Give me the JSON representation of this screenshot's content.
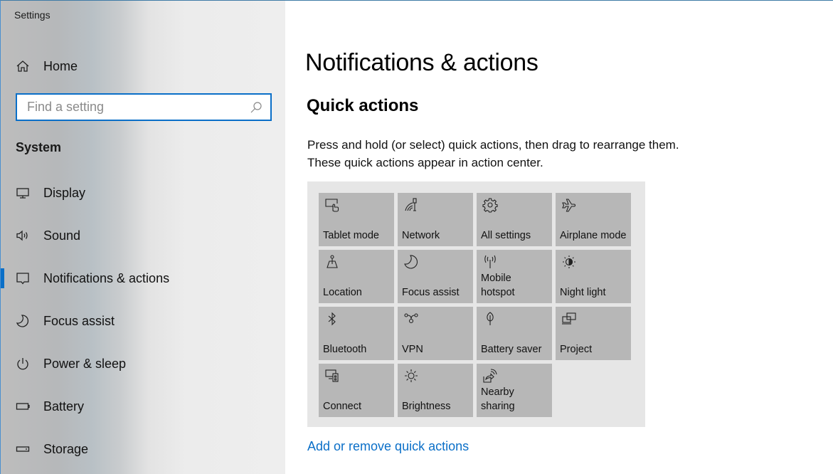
{
  "window": {
    "title": "Settings"
  },
  "sidebar": {
    "home": {
      "label": "Home",
      "icon": "home-icon"
    },
    "search": {
      "placeholder": "Find a setting",
      "value": "",
      "icon": "search-icon"
    },
    "section_label": "System",
    "items": [
      {
        "label": "Display",
        "icon": "display-icon",
        "active": false
      },
      {
        "label": "Sound",
        "icon": "speaker-icon",
        "active": false
      },
      {
        "label": "Notifications & actions",
        "icon": "notification-icon",
        "active": true
      },
      {
        "label": "Focus assist",
        "icon": "moon-icon",
        "active": false
      },
      {
        "label": "Power & sleep",
        "icon": "power-icon",
        "active": false
      },
      {
        "label": "Battery",
        "icon": "battery-icon",
        "active": false
      },
      {
        "label": "Storage",
        "icon": "storage-icon",
        "active": false
      }
    ]
  },
  "main": {
    "title": "Notifications & actions",
    "section_title": "Quick actions",
    "description": "Press and hold (or select) quick actions, then drag to rearrange them. These quick actions appear in action center.",
    "quick_actions": [
      {
        "label": "Tablet mode",
        "icon": "tablet-mode-icon"
      },
      {
        "label": "Network",
        "icon": "network-icon"
      },
      {
        "label": "All settings",
        "icon": "gear-icon"
      },
      {
        "label": "Airplane mode",
        "icon": "airplane-icon"
      },
      {
        "label": "Location",
        "icon": "location-icon"
      },
      {
        "label": "Focus assist",
        "icon": "moon-icon"
      },
      {
        "label": "Mobile\nhotspot",
        "icon": "hotspot-icon"
      },
      {
        "label": "Night light",
        "icon": "night-light-icon"
      },
      {
        "label": "Bluetooth",
        "icon": "bluetooth-icon"
      },
      {
        "label": "VPN",
        "icon": "vpn-icon"
      },
      {
        "label": "Battery saver",
        "icon": "battery-saver-icon"
      },
      {
        "label": "Project",
        "icon": "project-icon"
      },
      {
        "label": "Connect",
        "icon": "connect-icon"
      },
      {
        "label": "Brightness",
        "icon": "brightness-icon"
      },
      {
        "label": "Nearby\nsharing",
        "icon": "nearby-sharing-icon"
      }
    ],
    "link": "Add or remove quick actions"
  },
  "colors": {
    "accent": "#0a6fc8",
    "tile": "#b7b7b7",
    "panel": "#e6e6e6"
  }
}
